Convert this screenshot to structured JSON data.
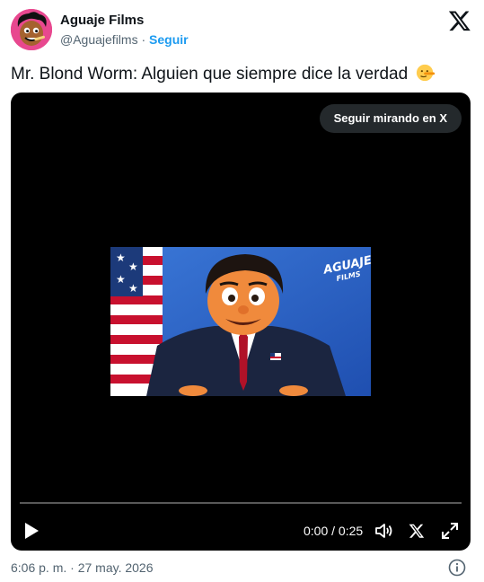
{
  "author": {
    "name": "Aguaje Films",
    "handle": "@Aguajefilms",
    "separator": "·",
    "follow_label": "Seguir",
    "avatar_icon": "cartoon-avatar-icon"
  },
  "platform_icon": "x-logo-icon",
  "tweet": {
    "text": "Mr. Blond Worm: Alguien que siempre dice la verdad",
    "emoji_icon": "lying-face-emoji-icon"
  },
  "video": {
    "watch_label": "Seguir mirando en X",
    "time": "0:00 / 0:25",
    "progress": 0,
    "thumbnail_logo": {
      "line1": "AGUAJE",
      "line2": "FILMS"
    },
    "controls": [
      "play-icon",
      "volume-icon",
      "x-logo-icon",
      "expand-icon"
    ]
  },
  "footer": {
    "timestamp": "6:06 p. m. · 27 may. 2026",
    "info_icon": "info-icon"
  },
  "colors": {
    "accent": "#1d9bf0",
    "text": "#0f1419",
    "muted": "#536471",
    "video_bg": "#000000",
    "thumb_bg": "#2a60c8"
  }
}
